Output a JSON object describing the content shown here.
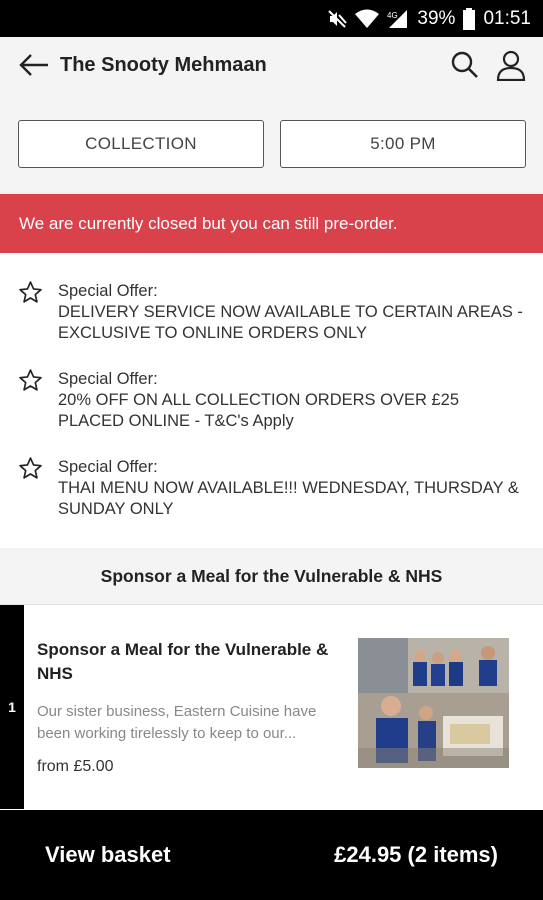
{
  "status_bar": {
    "battery": "39%",
    "time": "01:51",
    "network": "4G",
    "icons": [
      "mute-icon",
      "wifi-icon",
      "signal-icon",
      "battery-icon"
    ]
  },
  "header": {
    "title": "The Snooty Mehmaan",
    "back_icon": "back-arrow-icon",
    "search_icon": "search-icon",
    "account_icon": "account-icon"
  },
  "order_options": {
    "mode": "COLLECTION",
    "time": "5:00 PM"
  },
  "notice": {
    "text": "We are currently closed but you can still pre-order.",
    "color": "#d9414b"
  },
  "offers": [
    {
      "label": "Special Offer:",
      "text": "DELIVERY SERVICE NOW AVAILABLE TO CERTAIN AREAS - EXCLUSIVE TO ONLINE ORDERS ONLY"
    },
    {
      "label": "Special Offer:",
      "text": "20% OFF ON ALL COLLECTION ORDERS OVER £25 PLACED ONLINE - T&C's Apply"
    },
    {
      "label": "Special Offer:",
      "text": "THAI MENU NOW AVAILABLE!!! WEDNESDAY, THURSDAY & SUNDAY ONLY"
    }
  ],
  "section": {
    "title": "Sponsor a Meal for the Vulnerable & NHS"
  },
  "item": {
    "quantity": "1",
    "title": "Sponsor a Meal for the Vulnerable & NHS",
    "description": "Our sister business, Eastern Cuisine have been working tirelessly to keep to our...",
    "price": "from £5.00"
  },
  "basket": {
    "label": "View basket",
    "summary": "£24.95 (2 items)"
  }
}
